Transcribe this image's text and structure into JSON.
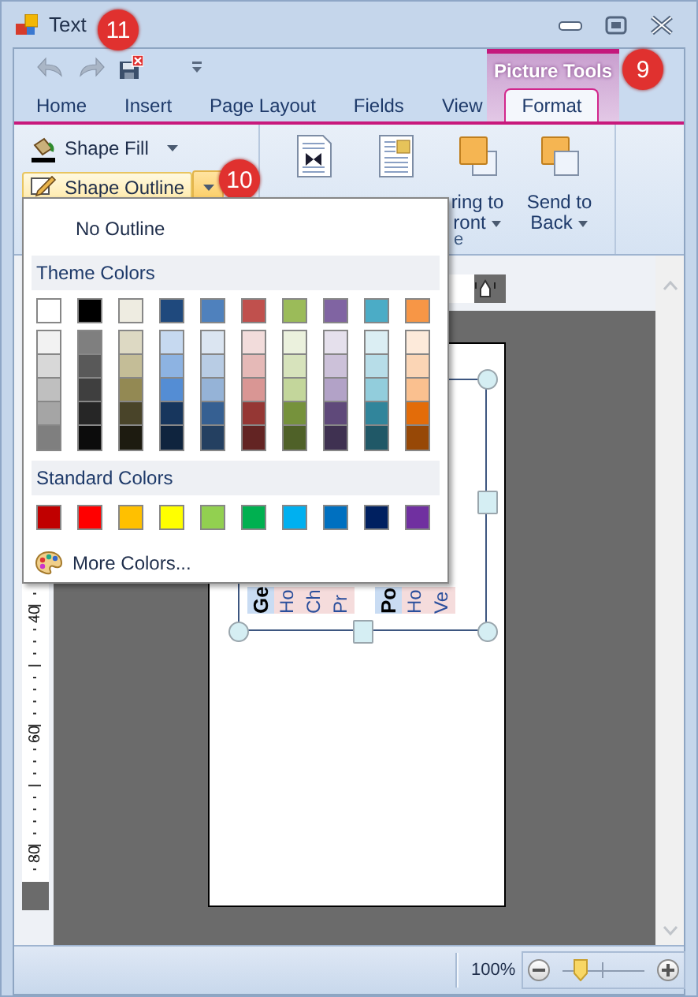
{
  "window": {
    "title": "Text",
    "callout": "11"
  },
  "contextual_tab": {
    "label": "Picture Tools",
    "callout": "9"
  },
  "tabs": [
    {
      "label": "Home",
      "selected": false
    },
    {
      "label": "Insert",
      "selected": false
    },
    {
      "label": "Page Layout",
      "selected": false
    },
    {
      "label": "Fields",
      "selected": false
    },
    {
      "label": "View",
      "selected": false
    },
    {
      "label": "Format",
      "selected": true
    }
  ],
  "ribbon": {
    "small_buttons": [
      {
        "kind": "fill",
        "label": "Shape Fill",
        "highlighted": false
      },
      {
        "kind": "outline",
        "label": "Shape Outline",
        "highlighted": true,
        "callout": "10"
      }
    ],
    "large_buttons": [
      {
        "kind": "wrap"
      },
      {
        "kind": "position"
      },
      {
        "kind": "bring",
        "lines": [
          "ring to",
          "ront"
        ],
        "dropdown": true
      },
      {
        "kind": "send",
        "lines": [
          "Send to",
          "Back"
        ],
        "dropdown": true
      }
    ],
    "group_label": "e"
  },
  "outline_menu": {
    "no_outline": "No Outline",
    "theme_heading": "Theme Colors",
    "theme_colors": [
      {
        "color": "#ffffff",
        "shades": [
          {
            "color": "#f2f2f2"
          },
          {
            "color": "#d8d8d8"
          },
          {
            "color": "#bfbfbf"
          },
          {
            "color": "#a5a5a5"
          },
          {
            "color": "#7f7f7f"
          }
        ]
      },
      {
        "color": "#000000",
        "shades": [
          {
            "color": "#7f7f7f"
          },
          {
            "color": "#595959"
          },
          {
            "color": "#3f3f3f"
          },
          {
            "color": "#262626"
          },
          {
            "color": "#0c0c0c"
          }
        ]
      },
      {
        "color": "#eeece1",
        "shades": [
          {
            "color": "#ddd9c3"
          },
          {
            "color": "#c4bd97"
          },
          {
            "color": "#938953"
          },
          {
            "color": "#494429"
          },
          {
            "color": "#1d1b10"
          }
        ]
      },
      {
        "color": "#1f497d",
        "shades": [
          {
            "color": "#c6d9f0"
          },
          {
            "color": "#8db3e2"
          },
          {
            "color": "#548dd4"
          },
          {
            "color": "#17365d"
          },
          {
            "color": "#0f243e"
          }
        ]
      },
      {
        "color": "#4f81bd",
        "shades": [
          {
            "color": "#dbe5f1"
          },
          {
            "color": "#b8cce4"
          },
          {
            "color": "#95b3d7"
          },
          {
            "color": "#366092"
          },
          {
            "color": "#244061"
          }
        ]
      },
      {
        "color": "#c0504d",
        "shades": [
          {
            "color": "#f2dcdb"
          },
          {
            "color": "#e5b9b7"
          },
          {
            "color": "#d99694"
          },
          {
            "color": "#953734"
          },
          {
            "color": "#632423"
          }
        ]
      },
      {
        "color": "#9bbb59",
        "shades": [
          {
            "color": "#ebf1dd"
          },
          {
            "color": "#d7e3bc"
          },
          {
            "color": "#c3d69b"
          },
          {
            "color": "#76923c"
          },
          {
            "color": "#4f6128"
          }
        ]
      },
      {
        "color": "#8064a2",
        "shades": [
          {
            "color": "#e5e0ec"
          },
          {
            "color": "#ccc1d9"
          },
          {
            "color": "#b2a2c7"
          },
          {
            "color": "#5f497a"
          },
          {
            "color": "#3f3151"
          }
        ]
      },
      {
        "color": "#4bacc6",
        "shades": [
          {
            "color": "#dbeef3"
          },
          {
            "color": "#b7dde8"
          },
          {
            "color": "#92cddc"
          },
          {
            "color": "#31859b"
          },
          {
            "color": "#205867"
          }
        ]
      },
      {
        "color": "#f79646",
        "shades": [
          {
            "color": "#fdeada"
          },
          {
            "color": "#fbd5b5"
          },
          {
            "color": "#fac08f"
          },
          {
            "color": "#e36c09"
          },
          {
            "color": "#974806"
          }
        ]
      }
    ],
    "standard_heading": "Standard Colors",
    "standard_colors": [
      {
        "color": "#c00000"
      },
      {
        "color": "#ff0000"
      },
      {
        "color": "#ffc000"
      },
      {
        "color": "#ffff00"
      },
      {
        "color": "#92d050"
      },
      {
        "color": "#00b050"
      },
      {
        "color": "#00b0f0"
      },
      {
        "color": "#0070c0"
      },
      {
        "color": "#002060"
      },
      {
        "color": "#7030a0"
      }
    ],
    "more_colors": "More Colors..."
  },
  "vertical_ruler": {
    "labels": [
      "40",
      "60",
      "80"
    ]
  },
  "shape_text": [
    {
      "text": "Ge",
      "kind": "heading"
    },
    {
      "text": "Ho",
      "kind": "item"
    },
    {
      "text": "Ch",
      "kind": "item"
    },
    {
      "text": "Pr",
      "kind": "item"
    },
    {
      "text": "Po",
      "kind": "heading"
    },
    {
      "text": "Ho",
      "kind": "item"
    },
    {
      "text": "Ve",
      "kind": "item"
    }
  ],
  "status_bar": {
    "zoom": "100%",
    "level": 0.2
  }
}
